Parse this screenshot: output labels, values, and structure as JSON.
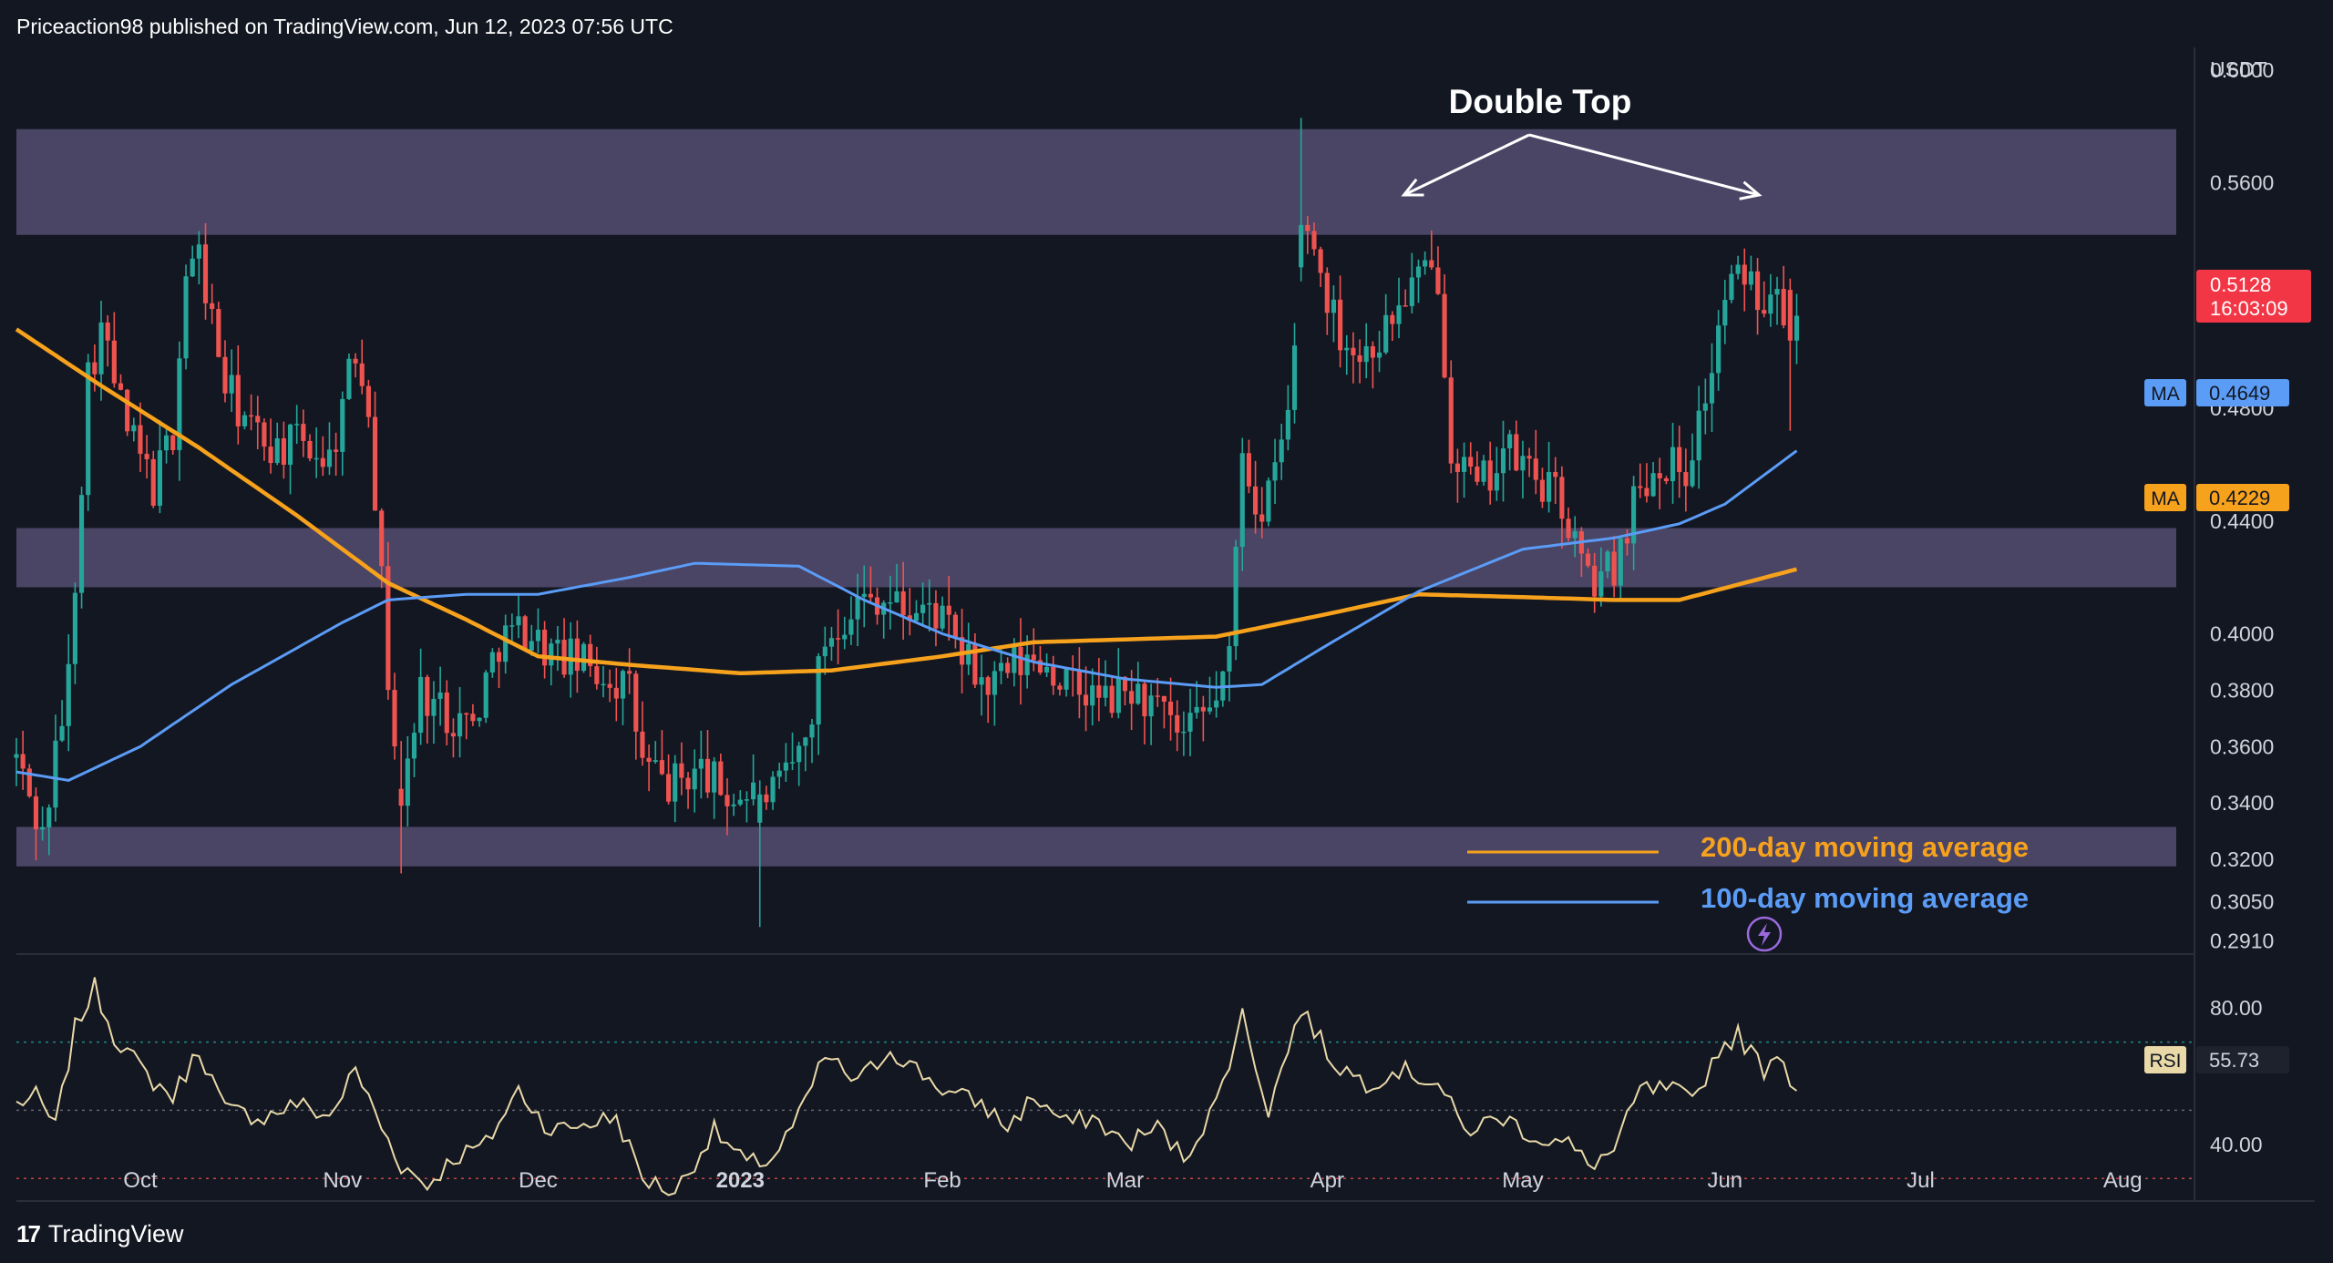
{
  "header": {
    "published_line": "Priceaction98 published on TradingView.com, Jun 12, 2023 07:56 UTC"
  },
  "footer": {
    "logo_glyph": "17",
    "brand": "TradingView"
  },
  "colors": {
    "background": "#131722",
    "up": "#26a69a",
    "down": "#ef5350",
    "ma100": "#5b9cf6",
    "ma200": "#f7a21c",
    "zone": "#524b6e",
    "rsi_line": "#e9d9a8",
    "last_price": "#f23645",
    "axis_text": "#d1d4dc"
  },
  "chart_data": [
    {
      "type": "candlestick",
      "title": "",
      "price_axis_unit": "USDT",
      "ylim": [
        0.288,
        0.608
      ],
      "y_ticks": [
        "0.6000",
        "0.5600",
        "0.5200",
        "0.4800",
        "0.4400",
        "0.4000",
        "0.3800",
        "0.3600",
        "0.3400",
        "0.3200",
        "0.3050",
        "0.2910"
      ],
      "x_axis_labels": [
        "Oct",
        "Nov",
        "Dec",
        "2023",
        "Feb",
        "Mar",
        "Apr",
        "May",
        "Jun",
        "Jul",
        "Aug"
      ],
      "x_axis_dates": [
        "2022-10-01",
        "2022-11-01",
        "2022-12-01",
        "2023-01-01",
        "2023-02-01",
        "2023-03-01",
        "2023-04-01",
        "2023-05-01",
        "2023-06-01",
        "2023-07-01",
        "2023-08-01"
      ],
      "date_range": [
        "2022-09-12",
        "2023-06-12"
      ],
      "axis_end_date": "2023-08-12",
      "price_knots": [
        [
          "2022-09-12",
          0.356
        ],
        [
          "2022-09-16",
          0.328
        ],
        [
          "2022-09-20",
          0.385
        ],
        [
          "2022-09-23",
          0.492
        ],
        [
          "2022-09-25",
          0.508
        ],
        [
          "2022-09-29",
          0.472
        ],
        [
          "2022-10-03",
          0.452
        ],
        [
          "2022-10-06",
          0.472
        ],
        [
          "2022-10-08",
          0.528
        ],
        [
          "2022-10-10",
          0.534
        ],
        [
          "2022-10-14",
          0.488
        ],
        [
          "2022-10-18",
          0.472
        ],
        [
          "2022-10-22",
          0.466
        ],
        [
          "2022-10-26",
          0.468
        ],
        [
          "2022-10-30",
          0.462
        ],
        [
          "2022-11-03",
          0.5
        ],
        [
          "2022-11-05",
          0.484
        ],
        [
          "2022-11-08",
          0.385
        ],
        [
          "2022-11-10",
          0.339
        ],
        [
          "2022-11-13",
          0.38
        ],
        [
          "2022-11-17",
          0.372
        ],
        [
          "2022-11-21",
          0.368
        ],
        [
          "2022-11-25",
          0.398
        ],
        [
          "2022-11-29",
          0.402
        ],
        [
          "2022-12-03",
          0.393
        ],
        [
          "2022-12-07",
          0.39
        ],
        [
          "2022-12-12",
          0.385
        ],
        [
          "2022-12-15",
          0.38
        ],
        [
          "2022-12-17",
          0.354
        ],
        [
          "2022-12-21",
          0.346
        ],
        [
          "2022-12-26",
          0.352
        ],
        [
          "2022-12-30",
          0.342
        ],
        [
          "2023-01-03",
          0.343
        ],
        [
          "2023-01-07",
          0.344
        ],
        [
          "2023-01-11",
          0.362
        ],
        [
          "2023-01-14",
          0.398
        ],
        [
          "2023-01-18",
          0.41
        ],
        [
          "2023-01-22",
          0.414
        ],
        [
          "2023-01-27",
          0.408
        ],
        [
          "2023-01-31",
          0.408
        ],
        [
          "2023-02-04",
          0.392
        ],
        [
          "2023-02-08",
          0.38
        ],
        [
          "2023-02-12",
          0.388
        ],
        [
          "2023-02-16",
          0.391
        ],
        [
          "2023-02-21",
          0.38
        ],
        [
          "2023-02-26",
          0.376
        ],
        [
          "2023-03-02",
          0.38
        ],
        [
          "2023-03-06",
          0.372
        ],
        [
          "2023-03-10",
          0.362
        ],
        [
          "2023-03-14",
          0.373
        ],
        [
          "2023-03-17",
          0.39
        ],
        [
          "2023-03-19",
          0.468
        ],
        [
          "2023-03-22",
          0.438
        ],
        [
          "2023-03-26",
          0.478
        ],
        [
          "2023-03-29",
          0.545
        ],
        [
          "2023-04-02",
          0.512
        ],
        [
          "2023-04-06",
          0.498
        ],
        [
          "2023-04-10",
          0.508
        ],
        [
          "2023-04-14",
          0.524
        ],
        [
          "2023-04-18",
          0.528
        ],
        [
          "2023-04-20",
          0.468
        ],
        [
          "2023-04-24",
          0.45
        ],
        [
          "2023-04-28",
          0.465
        ],
        [
          "2023-05-02",
          0.458
        ],
        [
          "2023-05-07",
          0.446
        ],
        [
          "2023-05-11",
          0.418
        ],
        [
          "2023-05-15",
          0.424
        ],
        [
          "2023-05-18",
          0.448
        ],
        [
          "2023-05-22",
          0.462
        ],
        [
          "2023-05-26",
          0.458
        ],
        [
          "2023-05-30",
          0.494
        ],
        [
          "2023-06-01",
          0.52
        ],
        [
          "2023-06-04",
          0.528
        ],
        [
          "2023-06-07",
          0.52
        ],
        [
          "2023-06-09",
          0.53
        ],
        [
          "2023-06-11",
          0.504
        ],
        [
          "2023-06-12",
          0.5128
        ]
      ],
      "ma100_knots": [
        [
          "2022-09-12",
          0.351
        ],
        [
          "2022-09-20",
          0.348
        ],
        [
          "2022-10-01",
          0.36
        ],
        [
          "2022-10-15",
          0.382
        ],
        [
          "2022-11-01",
          0.404
        ],
        [
          "2022-11-08",
          0.412
        ],
        [
          "2022-11-20",
          0.414
        ],
        [
          "2022-12-01",
          0.414
        ],
        [
          "2022-12-15",
          0.42
        ],
        [
          "2022-12-25",
          0.425
        ],
        [
          "2023-01-10",
          0.424
        ],
        [
          "2023-01-20",
          0.412
        ],
        [
          "2023-02-01",
          0.4
        ],
        [
          "2023-02-15",
          0.39
        ],
        [
          "2023-03-01",
          0.384
        ],
        [
          "2023-03-15",
          0.381
        ],
        [
          "2023-03-22",
          0.382
        ],
        [
          "2023-04-01",
          0.396
        ],
        [
          "2023-04-15",
          0.415
        ],
        [
          "2023-05-01",
          0.43
        ],
        [
          "2023-05-15",
          0.434
        ],
        [
          "2023-05-25",
          0.439
        ],
        [
          "2023-06-01",
          0.446
        ],
        [
          "2023-06-12",
          0.4649
        ]
      ],
      "ma200_knots": [
        [
          "2022-09-12",
          0.508
        ],
        [
          "2022-09-25",
          0.488
        ],
        [
          "2022-10-10",
          0.466
        ],
        [
          "2022-10-25",
          0.442
        ],
        [
          "2022-11-08",
          0.418
        ],
        [
          "2022-11-20",
          0.405
        ],
        [
          "2022-12-01",
          0.392
        ],
        [
          "2022-12-15",
          0.389
        ],
        [
          "2023-01-01",
          0.386
        ],
        [
          "2023-01-15",
          0.387
        ],
        [
          "2023-02-01",
          0.392
        ],
        [
          "2023-02-15",
          0.397
        ],
        [
          "2023-03-01",
          0.398
        ],
        [
          "2023-03-15",
          0.399
        ],
        [
          "2023-04-01",
          0.407
        ],
        [
          "2023-04-15",
          0.414
        ],
        [
          "2023-05-01",
          0.413
        ],
        [
          "2023-05-15",
          0.412
        ],
        [
          "2023-05-25",
          0.412
        ],
        [
          "2023-06-12",
          0.4229
        ]
      ],
      "zones": [
        {
          "from": 0.5415,
          "to": 0.579
        },
        {
          "from": 0.4165,
          "to": 0.4375
        },
        {
          "from": 0.3175,
          "to": 0.3315
        }
      ],
      "special_wicks": [
        [
          "2023-01-04",
          0.333,
          0.343,
          0.296,
          0.348
        ],
        [
          "2022-11-10",
          0.345,
          0.339,
          0.315,
          0.362
        ],
        [
          "2023-03-28",
          0.53,
          0.545,
          0.525,
          0.583
        ],
        [
          "2023-06-11",
          0.522,
          0.504,
          0.472,
          0.526
        ]
      ],
      "last_price": {
        "value": "0.5128",
        "countdown": "16:03:09"
      },
      "ma100_badge": {
        "label": "MA",
        "value": "0.4649"
      },
      "ma200_badge": {
        "label": "MA",
        "value": "0.4229"
      },
      "annotation": {
        "text": "Double Top",
        "peaks": [
          "2023-04-15",
          "2023-06-04"
        ]
      },
      "legend": [
        {
          "name": "200-day moving average",
          "color": "#f7a21c"
        },
        {
          "name": "100-day moving average",
          "color": "#5b9cf6"
        }
      ]
    },
    {
      "type": "line",
      "title": "",
      "indicator": "RSI",
      "ylim": [
        25,
        95
      ],
      "y_ticks": [
        "80.00",
        "40.00"
      ],
      "bands": [
        70,
        50,
        30
      ],
      "last_value": {
        "label": "RSI",
        "value": "55.73"
      },
      "rsi_knots": [
        [
          "2022-09-12",
          52
        ],
        [
          "2022-09-15",
          54
        ],
        [
          "2022-09-18",
          45
        ],
        [
          "2022-09-21",
          74
        ],
        [
          "2022-09-24",
          86
        ],
        [
          "2022-09-27",
          72
        ],
        [
          "2022-10-02",
          60
        ],
        [
          "2022-10-06",
          54
        ],
        [
          "2022-10-10",
          68
        ],
        [
          "2022-10-14",
          50
        ],
        [
          "2022-10-20",
          48
        ],
        [
          "2022-10-25",
          52
        ],
        [
          "2022-10-30",
          48
        ],
        [
          "2022-11-03",
          62
        ],
        [
          "2022-11-07",
          45
        ],
        [
          "2022-11-10",
          34
        ],
        [
          "2022-11-14",
          28
        ],
        [
          "2022-11-18",
          36
        ],
        [
          "2022-11-23",
          40
        ],
        [
          "2022-11-28",
          56
        ],
        [
          "2022-12-03",
          44
        ],
        [
          "2022-12-08",
          46
        ],
        [
          "2022-12-13",
          48
        ],
        [
          "2022-12-17",
          30
        ],
        [
          "2022-12-22",
          26
        ],
        [
          "2022-12-28",
          44
        ],
        [
          "2023-01-02",
          34
        ],
        [
          "2023-01-06",
          36
        ],
        [
          "2023-01-10",
          48
        ],
        [
          "2023-01-14",
          66
        ],
        [
          "2023-01-19",
          58
        ],
        [
          "2023-01-24",
          68
        ],
        [
          "2023-01-28",
          62
        ],
        [
          "2023-02-02",
          55
        ],
        [
          "2023-02-07",
          52
        ],
        [
          "2023-02-11",
          45
        ],
        [
          "2023-02-15",
          54
        ],
        [
          "2023-02-20",
          46
        ],
        [
          "2023-02-24",
          48
        ],
        [
          "2023-03-01",
          40
        ],
        [
          "2023-03-06",
          45
        ],
        [
          "2023-03-10",
          36
        ],
        [
          "2023-03-15",
          52
        ],
        [
          "2023-03-19",
          78
        ],
        [
          "2023-03-23",
          50
        ],
        [
          "2023-03-28",
          80
        ],
        [
          "2023-04-02",
          64
        ],
        [
          "2023-04-07",
          58
        ],
        [
          "2023-04-12",
          62
        ],
        [
          "2023-04-18",
          58
        ],
        [
          "2023-04-22",
          44
        ],
        [
          "2023-04-28",
          48
        ],
        [
          "2023-05-03",
          42
        ],
        [
          "2023-05-08",
          40
        ],
        [
          "2023-05-11",
          34
        ],
        [
          "2023-05-15",
          38
        ],
        [
          "2023-05-19",
          56
        ],
        [
          "2023-05-24",
          56
        ],
        [
          "2023-05-27",
          52
        ],
        [
          "2023-05-31",
          68
        ],
        [
          "2023-06-03",
          72
        ],
        [
          "2023-06-07",
          62
        ],
        [
          "2023-06-09",
          68
        ],
        [
          "2023-06-12",
          55.73
        ]
      ]
    }
  ]
}
